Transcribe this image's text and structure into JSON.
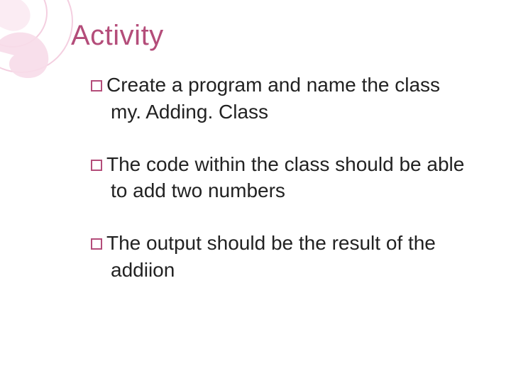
{
  "title": "Activity",
  "bullets": [
    {
      "lead": "Create",
      "rest": " a program and name the class my. Adding. Class"
    },
    {
      "lead": "The",
      "rest": " code within the class should be able to add two numbers"
    },
    {
      "lead": "The",
      "rest": " output should be the result of the addiion"
    }
  ]
}
